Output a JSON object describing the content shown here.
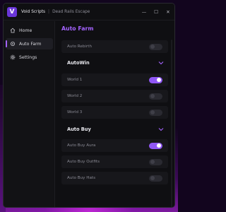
{
  "window": {
    "title": "Void Scripts",
    "separator": "|",
    "subtitle": "Dead Rails Escape",
    "logo_letter": "V",
    "controls": {
      "minimize": "—",
      "maximize": "☐",
      "close": "✕"
    }
  },
  "sidebar": {
    "items": [
      {
        "label": "Home",
        "icon": "home-icon",
        "active": false
      },
      {
        "label": "Auto Farm",
        "icon": "gear-target-icon",
        "active": true
      },
      {
        "label": "Settings",
        "icon": "gear-icon",
        "active": false
      }
    ]
  },
  "main": {
    "title": "Auto Farm",
    "auto_rebirth": {
      "label": "Auto Rebirth",
      "enabled": false
    },
    "autowin": {
      "header": "AutoWin",
      "items": [
        {
          "label": "World 1",
          "enabled": true
        },
        {
          "label": "World 2",
          "enabled": false
        },
        {
          "label": "World 3",
          "enabled": false
        }
      ]
    },
    "autobuy": {
      "header": "Auto Buy",
      "items": [
        {
          "label": "Auto Buy Aura",
          "enabled": true
        },
        {
          "label": "Auto Buy Outfits",
          "enabled": false
        },
        {
          "label": "Auto Buy Hats",
          "enabled": false
        }
      ]
    }
  },
  "colors": {
    "accent": "#a463ff",
    "toggle_on": "#9057f5",
    "background_glow": "#c828dc"
  }
}
